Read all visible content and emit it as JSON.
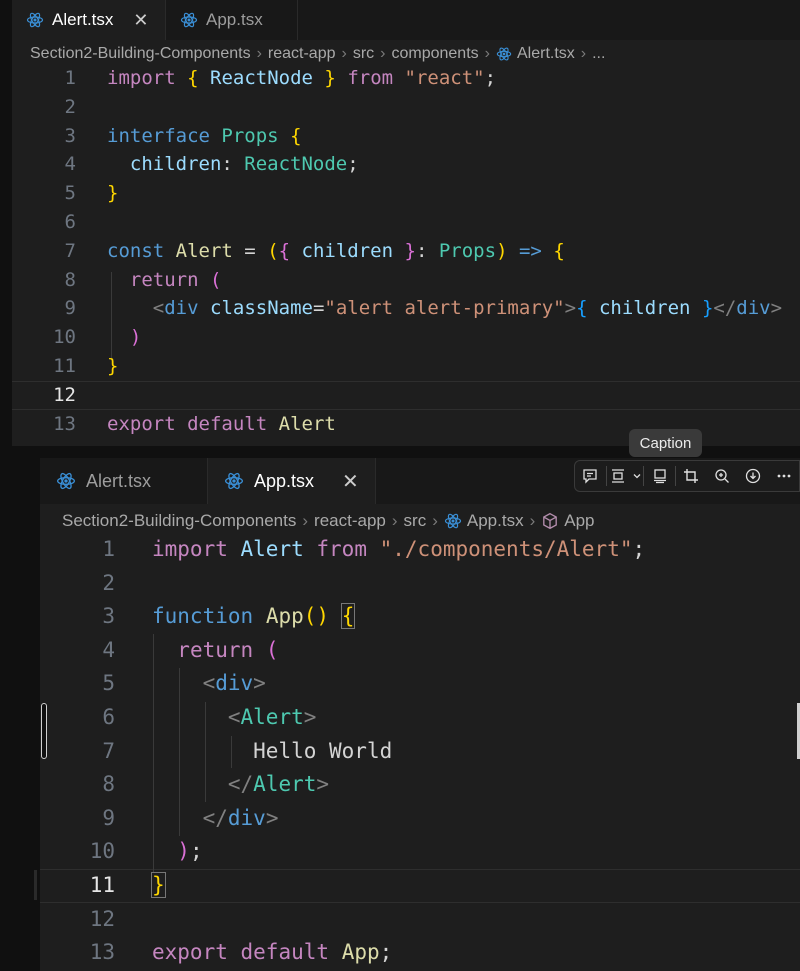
{
  "top_editor": {
    "tabs": [
      {
        "label": "Alert.tsx",
        "active": true,
        "close": "✕"
      },
      {
        "label": "App.tsx",
        "active": false,
        "close": ""
      }
    ],
    "breadcrumb": [
      "Section2-Building-Components",
      "react-app",
      "src",
      "components",
      "Alert.tsx",
      "..."
    ],
    "line_numbers": [
      "1",
      "2",
      "3",
      "4",
      "5",
      "6",
      "7",
      "8",
      "9",
      "10",
      "11",
      "12",
      "13"
    ],
    "current_line": 12,
    "code_lines": [
      "import { ReactNode } from \"react\";",
      "",
      "interface Props {",
      "  children: ReactNode;",
      "}",
      "",
      "const Alert = ({ children }: Props) => {",
      "  return (",
      "    <div className=\"alert alert-primary\">{ children }</div>",
      "  )",
      "}",
      "",
      "export default Alert"
    ]
  },
  "bottom_editor": {
    "tabs": [
      {
        "label": "Alert.tsx",
        "active": false,
        "close": ""
      },
      {
        "label": "App.tsx",
        "active": true,
        "close": "✕"
      }
    ],
    "breadcrumb": [
      "Section2-Building-Components",
      "react-app",
      "src",
      "App.tsx",
      "App"
    ],
    "line_numbers": [
      "1",
      "2",
      "3",
      "4",
      "5",
      "6",
      "7",
      "8",
      "9",
      "10",
      "11",
      "12",
      "13"
    ],
    "current_line": 11,
    "code_lines": [
      "import Alert from \"./components/Alert\";",
      "",
      "function App() {",
      "  return (",
      "    <div>",
      "      <Alert>",
      "        Hello World",
      "      </Alert>",
      "    </div>",
      "  );",
      "}",
      "",
      "export default App;"
    ]
  },
  "overlay": {
    "caption_tooltip": "Caption",
    "toolbar_icons": [
      "comment-icon",
      "fit-icon",
      "chevron-down-icon",
      "caption-icon",
      "crop-icon",
      "zoom-in-icon",
      "download-icon",
      "more-icon"
    ]
  },
  "colors": {
    "editor_bg": "#1e1e1e",
    "tab_bar_bg": "#181818",
    "keyword": "#c586c0",
    "keyword_blue": "#569cd6",
    "type": "#4ec9b0",
    "variable": "#9cdcfe",
    "string": "#ce9178",
    "function": "#dcdcaa"
  }
}
